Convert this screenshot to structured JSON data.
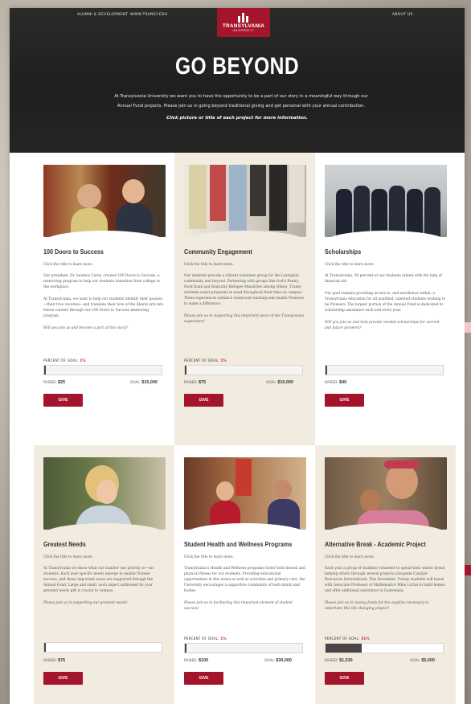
{
  "nav": {
    "alumni": "ALUMNI & DEVELOPMENT",
    "site": "WWW.TRANSY.EDU",
    "about": "ABOUT US"
  },
  "logo": {
    "name": "TRANSYLVANIA",
    "sub": "UNIVERSITY"
  },
  "hero": {
    "title": "GO BEYOND",
    "line1": "At Transylvania University we want you to have the opportunity to be a part of our story in a meaningful way through our",
    "line2": "Annual Fund projects. Please join us in going beyond traditional giving and get personal with your annual contribution.",
    "cta": "Click picture or title of each project for more information."
  },
  "cards": [
    {
      "title": "100 Doors to Success",
      "hint": "Click the title to learn more.",
      "p1": "Our president, Dr. Seamus Carey, created 100 Doors to Success, a mentoring program to help our students transition from college to the workplace.",
      "p2": "At Transylvania, we want to help our students identify their passion—their true vocation—and translate their love of the liberal arts into future careers through our 100 Doors to Success mentoring program.",
      "p3": "Will you join us and become a part of this story?",
      "goal_label": "PERCENT OF GOAL:",
      "goal_pct": "1%",
      "pct_value": 0.01,
      "raised_label": "RAISED:",
      "raised": "$25",
      "goal_text": "GOAL:",
      "goal": "$15,000",
      "give": "GIVE"
    },
    {
      "title": "Community Engagement",
      "hint": "Click the title to learn more.",
      "p1": "Our students provide a vibrant volunteer group for the Lexington community and beyond. Partnering with groups like God's Pantry Food Bank and Kentucky Refugee Ministries among others, Transy students assist programs in need throughout their time on campus. These experiences enhance classroom learning and enable Pioneers to make a difference.",
      "p2": "Please join us in supporting this important piece of the Transylvania experience!",
      "goal_label": "PERCENT OF GOAL:",
      "goal_pct": "1%",
      "pct_value": 0.01,
      "raised_label": "RAISED:",
      "raised": "$75",
      "goal_text": "GOAL:",
      "goal": "$10,000",
      "give": "GIVE"
    },
    {
      "title": "Scholarships",
      "hint": "Click the title to learn more.",
      "p1": "At Transylvania, 96 percent of our students attend with the help of financial aid.",
      "p2": "Our goal remains providing access to, and excellence within, a Transylvania education for all qualified, talented students wishing to be Pioneers. The largest portion of the Annual Fund is dedicated to scholarship assistance each and every year.",
      "p3": "Will you join us and help provide needed scholarships for current and future pioneers?",
      "pct_value": 0.005,
      "raised_label": "RAISED:",
      "raised": "$40",
      "give": "GIVE"
    },
    {
      "title": "Greatest Needs",
      "hint": "Click the title to learn more.",
      "p1": "At Transylvania we know what our number one priority is—our students. Each year specific needs emerge to enable Pioneer success, and these important areas are supported through the Annual Fund. Large and small, each aspect addressed by your greatest needs gift is crucial to campus.",
      "p2": "Please join us in supporting our greatest needs!",
      "pct_value": 0.005,
      "raised_label": "RAISED:",
      "raised": "$75",
      "give": "GIVE"
    },
    {
      "title": "Student Health and Wellness Programs",
      "hint": "Click the title to learn more.",
      "p1": "Transylvania's Health and Wellness programs foster both mental and physical fitness for our students. Providing educational opportunities in this arena as well as activities and primary care, the University encourages a supportive community of both minds and bodies.",
      "p2": "Please join us in facilitating this important element of student success!",
      "goal_label": "PERCENT OF GOAL:",
      "goal_pct": "1%",
      "pct_value": 0.01,
      "raised_label": "RAISED:",
      "raised": "$100",
      "goal_text": "GOAL:",
      "goal": "$30,000",
      "give": "GIVE"
    },
    {
      "title": "Alternative Break - Academic Project",
      "hint": "Click the title to learn more.",
      "p1": "Each year a group of students volunteer to spend their winter break helping others through several projects alongside Catalyst Resources International. This December, Transy students will travel with Associate Professor of Mathematics Mike LoVan to build homes and offer additional assistance in Guatemala.",
      "p2": "Please join us in raising funds for the supplies necessary to undertake this life changing project!",
      "goal_label": "PERCENT OF GOAL:",
      "goal_pct": "31%",
      "pct_value": 0.31,
      "raised_label": "RAISED:",
      "raised": "$1,530",
      "goal_text": "GOAL:",
      "goal": "$5,000",
      "give": "GIVE"
    }
  ],
  "colors": {
    "brand": "#a4142b",
    "accent_text": "#c61f3b",
    "tint": "#f1ecdf"
  }
}
